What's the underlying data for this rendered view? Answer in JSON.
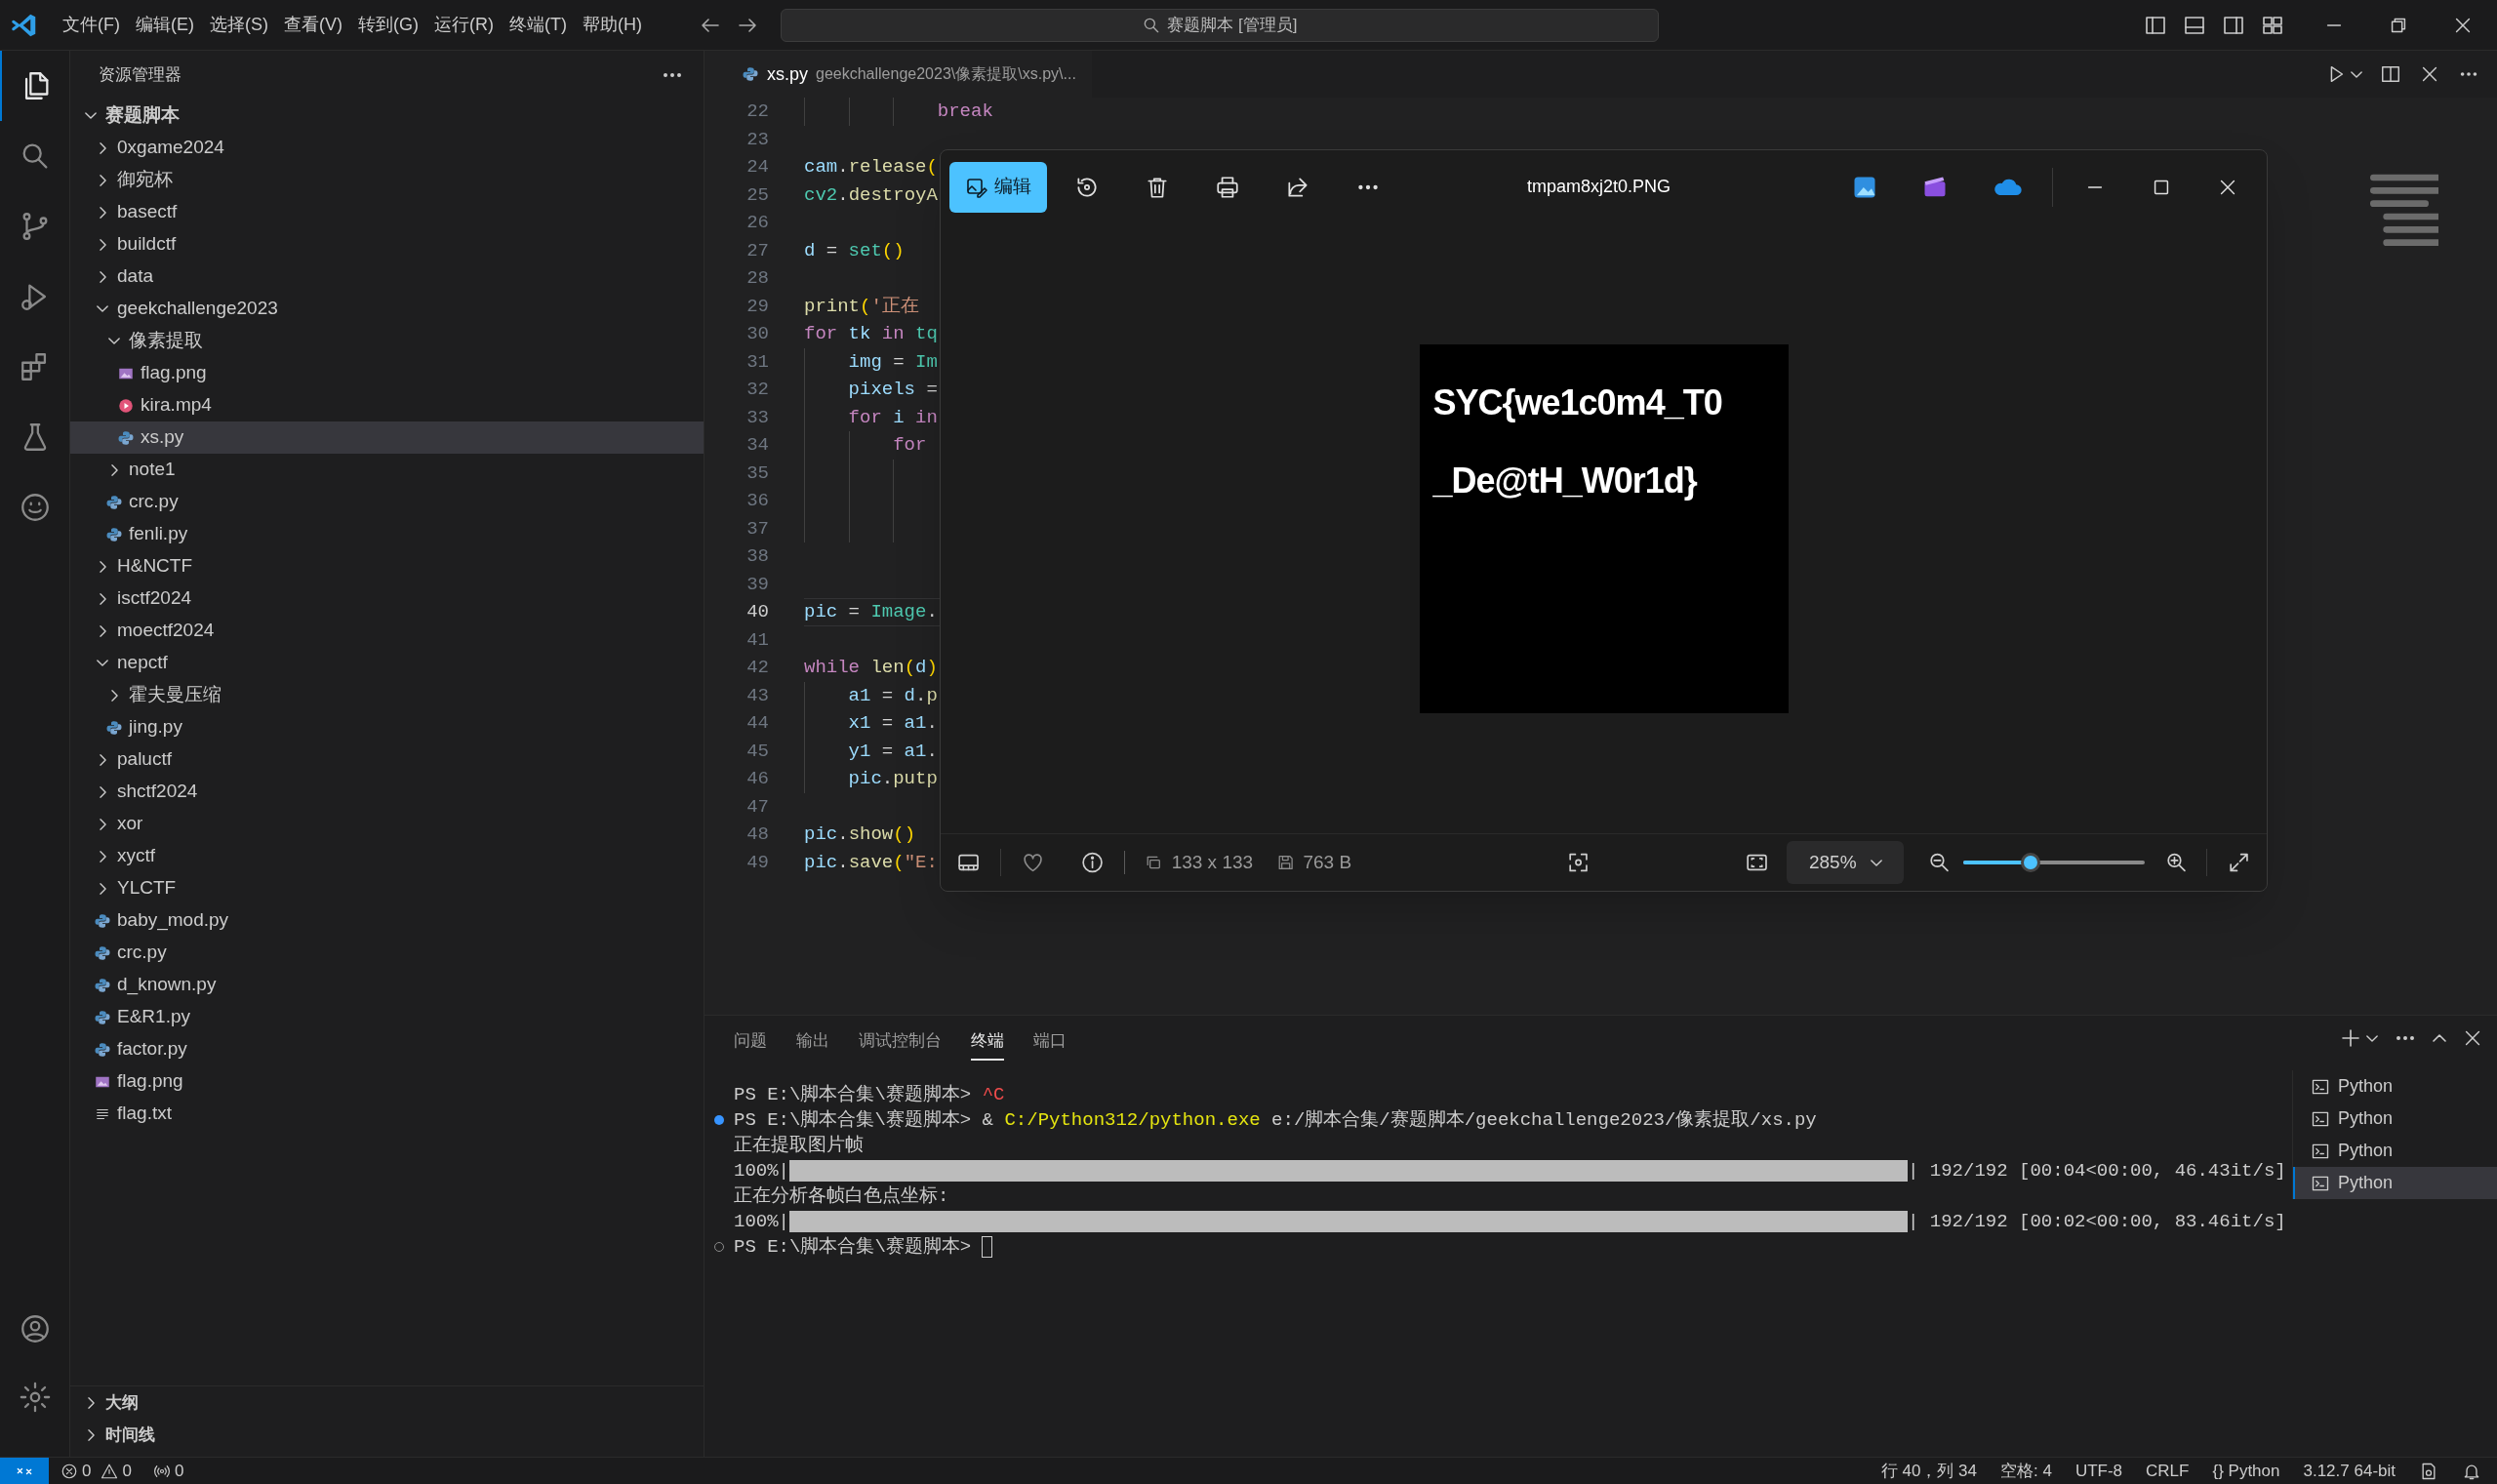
{
  "titlebar": {
    "menus": [
      "文件(F)",
      "编辑(E)",
      "选择(S)",
      "查看(V)",
      "转到(G)",
      "运行(R)",
      "终端(T)",
      "帮助(H)"
    ],
    "search": "赛题脚本 [管理员]"
  },
  "activity_bar": [
    {
      "kind": "explorer",
      "selected": true
    },
    {
      "kind": "search",
      "selected": false
    },
    {
      "kind": "source-control",
      "selected": false
    },
    {
      "kind": "run",
      "selected": false
    },
    {
      "kind": "extensions",
      "selected": false
    },
    {
      "kind": "testing",
      "selected": false
    },
    {
      "kind": "remote",
      "selected": false
    }
  ],
  "sidebar": {
    "title": "资源管理器",
    "tree": [
      {
        "name": "赛题脚本",
        "kind": "folder",
        "expanded": true,
        "selected": false,
        "children": [
          {
            "name": "0xgame2024",
            "kind": "folder",
            "expanded": false,
            "selected": false
          },
          {
            "name": "御宛杯",
            "kind": "folder",
            "expanded": false,
            "selected": false
          },
          {
            "name": "basectf",
            "kind": "folder",
            "expanded": false,
            "selected": false
          },
          {
            "name": "buildctf",
            "kind": "folder",
            "expanded": false,
            "selected": false
          },
          {
            "name": "data",
            "kind": "folder",
            "expanded": false,
            "selected": false
          },
          {
            "name": "geekchallenge2023",
            "kind": "folder",
            "expanded": true,
            "selected": false,
            "children": [
              {
                "name": "像素提取",
                "kind": "folder",
                "expanded": true,
                "selected": false,
                "children": [
                  {
                    "name": "flag.png",
                    "kind": "image",
                    "selected": false
                  },
                  {
                    "name": "kira.mp4",
                    "kind": "video",
                    "selected": false
                  },
                  {
                    "name": "xs.py",
                    "kind": "python",
                    "selected": true
                  }
                ]
              },
              {
                "name": "note1",
                "kind": "folder",
                "expanded": false,
                "selected": false
              },
              {
                "name": "crc.py",
                "kind": "python",
                "selected": false
              },
              {
                "name": "fenli.py",
                "kind": "python",
                "selected": false
              }
            ]
          },
          {
            "name": "H&NCTF",
            "kind": "folder",
            "expanded": false,
            "selected": false
          },
          {
            "name": "isctf2024",
            "kind": "folder",
            "expanded": false,
            "selected": false
          },
          {
            "name": "moectf2024",
            "kind": "folder",
            "expanded": false,
            "selected": false
          },
          {
            "name": "nepctf",
            "kind": "folder",
            "expanded": true,
            "selected": false,
            "children": [
              {
                "name": "霍夫曼压缩",
                "kind": "folder",
                "expanded": false,
                "selected": false
              },
              {
                "name": "jing.py",
                "kind": "python",
                "selected": false
              }
            ]
          },
          {
            "name": "paluctf",
            "kind": "folder",
            "expanded": false,
            "selected": false
          },
          {
            "name": "shctf2024",
            "kind": "folder",
            "expanded": false,
            "selected": false
          },
          {
            "name": "xor",
            "kind": "folder",
            "expanded": false,
            "selected": false
          },
          {
            "name": "xyctf",
            "kind": "folder",
            "expanded": false,
            "selected": false
          },
          {
            "name": "YLCTF",
            "kind": "folder",
            "expanded": false,
            "selected": false
          },
          {
            "name": "baby_mod.py",
            "kind": "python",
            "selected": false
          },
          {
            "name": "crc.py",
            "kind": "python",
            "selected": false
          },
          {
            "name": "d_known.py",
            "kind": "python",
            "selected": false
          },
          {
            "name": "E&R1.py",
            "kind": "python",
            "selected": false
          },
          {
            "name": "factor.py",
            "kind": "python",
            "selected": false
          },
          {
            "name": "flag.png",
            "kind": "image",
            "selected": false
          },
          {
            "name": "flag.txt",
            "kind": "text",
            "selected": false
          }
        ]
      }
    ],
    "sections": [
      {
        "label": "大纲",
        "expanded": false
      },
      {
        "label": "时间线",
        "expanded": false
      }
    ]
  },
  "editor": {
    "tab": {
      "label": "xs.py",
      "path": "geekchallenge2023\\像素提取\\xs.py\\..."
    },
    "lines": [
      {
        "number": "22",
        "current": false,
        "kind": "deep",
        "tokens": [
          {
            "text": "break",
            "kind": "kw"
          }
        ]
      },
      {
        "number": "23",
        "current": false,
        "kind": "top"
      },
      {
        "number": "24",
        "current": false,
        "kind": "top",
        "tokens": [
          {
            "text": "cam",
            "kind": "var"
          },
          {
            "text": ".",
            "kind": "plain"
          },
          {
            "text": "release",
            "kind": "fn"
          },
          {
            "text": "(",
            "kind": "paren"
          }
        ]
      },
      {
        "number": "25",
        "current": false,
        "kind": "top",
        "tokens": [
          {
            "text": "cv2",
            "kind": "cls"
          },
          {
            "text": ".",
            "kind": "plain"
          },
          {
            "text": "destroyA",
            "kind": "fn"
          }
        ]
      },
      {
        "number": "26",
        "current": false,
        "kind": "top"
      },
      {
        "number": "27",
        "current": false,
        "kind": "top",
        "tokens": [
          {
            "text": "d",
            "kind": "var"
          },
          {
            "text": "=",
            "kind": "op"
          },
          {
            "text": "set",
            "kind": "cls"
          },
          {
            "text": "()",
            "kind": "paren"
          }
        ]
      },
      {
        "number": "28",
        "current": false,
        "kind": "top"
      },
      {
        "number": "29",
        "current": false,
        "kind": "top",
        "tokens": [
          {
            "text": "print",
            "kind": "fn"
          },
          {
            "text": "(",
            "kind": "paren"
          },
          {
            "text": "'正在",
            "kind": "str"
          }
        ]
      },
      {
        "number": "30",
        "current": false,
        "kind": "top",
        "tokens": [
          {
            "text": "for",
            "kind": "kw"
          },
          {
            "text": "tk",
            "kind": "var"
          },
          {
            "text": "in",
            "kind": "kw"
          },
          {
            "text": "tq",
            "kind": "cls"
          }
        ]
      },
      {
        "number": "31",
        "current": false,
        "kind": "block",
        "tokens": [
          {
            "text": "img",
            "kind": "var"
          },
          {
            "text": "=",
            "kind": "op"
          },
          {
            "text": "Im",
            "kind": "cls"
          }
        ]
      },
      {
        "number": "32",
        "current": false,
        "kind": "block",
        "tokens": [
          {
            "text": "pixels",
            "kind": "var"
          },
          {
            "text": "=",
            "kind": "op"
          }
        ]
      },
      {
        "number": "33",
        "current": false,
        "kind": "block",
        "tokens": [
          {
            "text": "for",
            "kind": "kw"
          },
          {
            "text": "i",
            "kind": "var"
          },
          {
            "text": "in",
            "kind": "kw"
          }
        ]
      },
      {
        "number": "34",
        "current": false,
        "kind": "nested",
        "tokens": [
          {
            "text": "for",
            "kind": "kw"
          }
        ]
      },
      {
        "number": "35",
        "current": false,
        "kind": "deep"
      },
      {
        "number": "36",
        "current": false,
        "kind": "deep"
      },
      {
        "number": "37",
        "current": false,
        "kind": "deep"
      },
      {
        "number": "38",
        "current": false,
        "kind": "top"
      },
      {
        "number": "39",
        "current": false,
        "kind": "top"
      },
      {
        "number": "40",
        "current": true,
        "kind": "top",
        "tokens": [
          {
            "text": "pic",
            "kind": "var"
          },
          {
            "text": "=",
            "kind": "op"
          },
          {
            "text": "Image",
            "kind": "cls"
          },
          {
            "text": ".",
            "kind": "plain"
          }
        ]
      },
      {
        "number": "41",
        "current": false,
        "kind": "top"
      },
      {
        "number": "42",
        "current": false,
        "kind": "top",
        "tokens": [
          {
            "text": "while",
            "kind": "kw"
          },
          {
            "text": "len",
            "kind": "fn"
          },
          {
            "text": "(",
            "kind": "paren"
          },
          {
            "text": "d",
            "kind": "var"
          },
          {
            "text": ")",
            "kind": "paren"
          }
        ]
      },
      {
        "number": "43",
        "current": false,
        "kind": "block",
        "tokens": [
          {
            "text": "a1",
            "kind": "var"
          },
          {
            "text": "=",
            "kind": "op"
          },
          {
            "text": "d",
            "kind": "var"
          },
          {
            "text": ".",
            "kind": "plain"
          },
          {
            "text": "p",
            "kind": "fn"
          }
        ]
      },
      {
        "number": "44",
        "current": false,
        "kind": "block",
        "tokens": [
          {
            "text": "x1",
            "kind": "var"
          },
          {
            "text": "=",
            "kind": "op"
          },
          {
            "text": "a1",
            "kind": "var"
          },
          {
            "text": ".",
            "kind": "plain"
          }
        ]
      },
      {
        "number": "45",
        "current": false,
        "kind": "block",
        "tokens": [
          {
            "text": "y1",
            "kind": "var"
          },
          {
            "text": "=",
            "kind": "op"
          },
          {
            "text": "a1",
            "kind": "var"
          },
          {
            "text": ".",
            "kind": "plain"
          }
        ]
      },
      {
        "number": "46",
        "current": false,
        "kind": "block",
        "tokens": [
          {
            "text": "pic",
            "kind": "var"
          },
          {
            "text": ".",
            "kind": "plain"
          },
          {
            "text": "putp",
            "kind": "fn"
          }
        ]
      },
      {
        "number": "47",
        "current": false,
        "kind": "top"
      },
      {
        "number": "48",
        "current": false,
        "kind": "top",
        "tokens": [
          {
            "text": "pic",
            "kind": "var"
          },
          {
            "text": ".",
            "kind": "plain"
          },
          {
            "text": "show",
            "kind": "fn"
          },
          {
            "text": "()",
            "kind": "paren"
          }
        ]
      },
      {
        "number": "49",
        "current": false,
        "kind": "top",
        "tokens": [
          {
            "text": "pic",
            "kind": "var"
          },
          {
            "text": ".",
            "kind": "plain"
          },
          {
            "text": "save",
            "kind": "fn"
          },
          {
            "text": "(",
            "kind": "paren"
          },
          {
            "text": "\"E:",
            "kind": "str"
          }
        ]
      }
    ]
  },
  "image_viewer": {
    "edit_button": "编辑",
    "title": "tmpam8xj2t0.PNG",
    "image_text": [
      "SYC{we1c0m4_T0",
      "_De@tH_W0r1d}"
    ],
    "dimensions": "133 x 133",
    "file_size": "763 B",
    "zoom": "285%",
    "zoom_slider": {
      "level": 0.37
    }
  },
  "panel": {
    "tabs": [
      {
        "label": "问题",
        "selected": false
      },
      {
        "label": "输出",
        "selected": false
      },
      {
        "label": "调试控制台",
        "selected": false
      },
      {
        "label": "终端",
        "selected": true
      },
      {
        "label": "端口",
        "selected": false
      }
    ],
    "terminal": [
      {
        "kind": "text",
        "success": false,
        "idle": false,
        "segments": [
          {
            "text": "PS E:\\脚本合集\\赛题脚本>",
            "kind": "plain"
          },
          {
            "text": "^C",
            "kind": "error"
          }
        ]
      },
      {
        "kind": "text",
        "success": true,
        "idle": false,
        "segments": [
          {
            "text": "PS E:\\脚本合集\\赛题脚本> &",
            "kind": "plain"
          },
          {
            "text": "C:/Python312/python.exe",
            "kind": "path"
          },
          {
            "text": "e:/脚本合集/赛题脚本/geekchallenge2023/像素提取/xs.py",
            "kind": "plain"
          }
        ]
      },
      {
        "kind": "text",
        "success": false,
        "idle": false,
        "segments": [
          {
            "text": "正在提取图片帧",
            "kind": "plain"
          }
        ]
      },
      {
        "kind": "progress",
        "success": false,
        "idle": false,
        "prefix": "100%|",
        "level": 1,
        "suffix": "| 192/192 [00:04<00:00, 46.43it/s]"
      },
      {
        "kind": "text",
        "success": false,
        "idle": false,
        "segments": [
          {
            "text": "正在分析各帧白色点坐标:",
            "kind": "plain"
          }
        ]
      },
      {
        "kind": "progress",
        "success": false,
        "idle": false,
        "prefix": "100%|",
        "level": 1,
        "suffix": "| 192/192 [00:02<00:00, 83.46it/s]"
      },
      {
        "kind": "text",
        "success": false,
        "idle": true,
        "cursor": true,
        "segments": [
          {
            "text": "PS E:\\脚本合集\\赛题脚本>",
            "kind": "plain"
          }
        ]
      }
    ],
    "terminals": [
      {
        "label": "Python",
        "selected": false
      },
      {
        "label": "Python",
        "selected": false
      },
      {
        "label": "Python",
        "selected": false
      },
      {
        "label": "Python",
        "selected": true
      }
    ]
  },
  "status_bar": {
    "errors": "0",
    "warnings": "0",
    "ports": "0",
    "items": [
      "行 40，列 34",
      "空格: 4",
      "UTF-8",
      "CRLF",
      "{} Python",
      "3.12.7 64-bit"
    ]
  }
}
